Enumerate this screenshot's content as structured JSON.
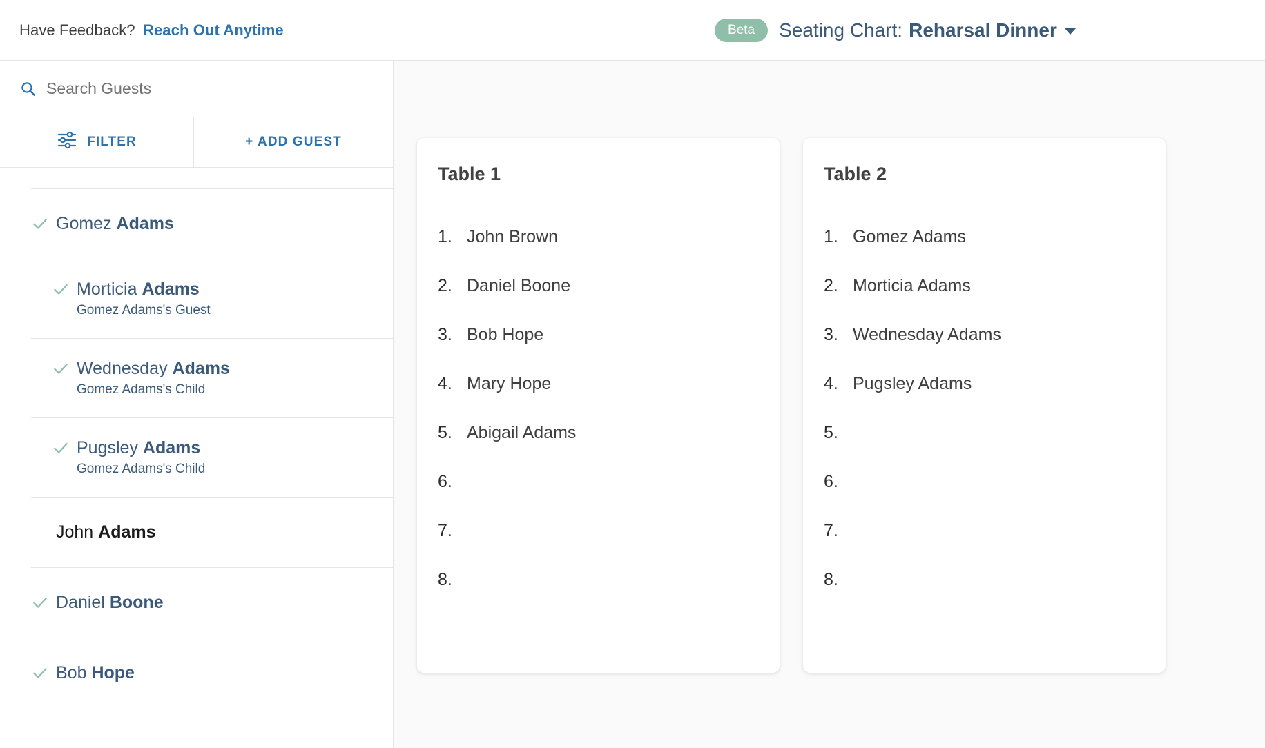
{
  "header": {
    "feedback_prompt": "Have Feedback?",
    "feedback_link": "Reach Out Anytime",
    "beta_badge": "Beta",
    "title_label": "Seating Chart:",
    "title_name": "Reharsal Dinner",
    "dropdown_icon": "chevron-down-icon",
    "accent_link_color": "#2c72ad",
    "badge_color": "#8fbfa8",
    "title_color": "#3b5a7a"
  },
  "sidebar": {
    "search": {
      "placeholder": "Search Guests",
      "value": "",
      "icon": "search-icon"
    },
    "tabs": [
      {
        "label": "FILTER",
        "icon": "sliders-filter-icon"
      },
      {
        "label": "+ ADD GUEST",
        "icon": "plus-icon"
      }
    ],
    "guests": [
      {
        "first": "Gomez",
        "last": "Adams",
        "relation": "",
        "checked": true,
        "level": 0,
        "assigned": true
      },
      {
        "first": "Morticia",
        "last": "Adams",
        "relation": "Gomez Adams's Guest",
        "checked": true,
        "level": 1,
        "assigned": true
      },
      {
        "first": "Wednesday",
        "last": "Adams",
        "relation": "Gomez Adams's Child",
        "checked": true,
        "level": 1,
        "assigned": true
      },
      {
        "first": "Pugsley",
        "last": "Adams",
        "relation": "Gomez Adams's Child",
        "checked": true,
        "level": 1,
        "assigned": true
      },
      {
        "first": "John",
        "last": "Adams",
        "relation": "",
        "checked": false,
        "level": 0,
        "assigned": false
      },
      {
        "first": "Daniel",
        "last": "Boone",
        "relation": "",
        "checked": true,
        "level": 0,
        "assigned": true
      },
      {
        "first": "Bob",
        "last": "Hope",
        "relation": "",
        "checked": true,
        "level": 0,
        "assigned": true
      }
    ]
  },
  "tables": [
    {
      "title": "Table 1",
      "seats": [
        {
          "num": "1.",
          "name": "John Brown"
        },
        {
          "num": "2.",
          "name": "Daniel Boone"
        },
        {
          "num": "3.",
          "name": "Bob Hope"
        },
        {
          "num": "4.",
          "name": "Mary Hope"
        },
        {
          "num": "5.",
          "name": "Abigail Adams"
        },
        {
          "num": "6.",
          "name": ""
        },
        {
          "num": "7.",
          "name": ""
        },
        {
          "num": "8.",
          "name": ""
        }
      ]
    },
    {
      "title": "Table 2",
      "seats": [
        {
          "num": "1.",
          "name": "Gomez Adams"
        },
        {
          "num": "2.",
          "name": "Morticia Adams"
        },
        {
          "num": "3.",
          "name": "Wednesday Adams"
        },
        {
          "num": "4.",
          "name": "Pugsley Adams"
        },
        {
          "num": "5.",
          "name": ""
        },
        {
          "num": "6.",
          "name": ""
        },
        {
          "num": "7.",
          "name": ""
        },
        {
          "num": "8.",
          "name": ""
        }
      ]
    }
  ]
}
